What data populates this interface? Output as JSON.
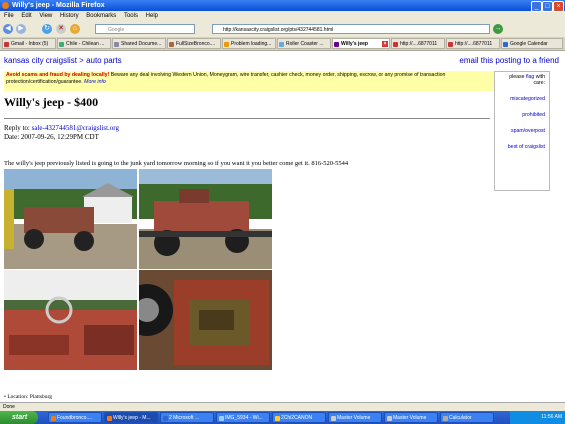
{
  "window": {
    "title": "Willy's jeep - Mozilla Firefox"
  },
  "menu": [
    "File",
    "Edit",
    "View",
    "History",
    "Bookmarks",
    "Tools",
    "Help"
  ],
  "nav": {
    "url": "http://kansascity.craigslist.org/pts/432744581.html",
    "search_placeholder": "Google"
  },
  "tabs": [
    {
      "label": "Gmail - Inbox (5)"
    },
    {
      "label": "Chile - Chilean ..."
    },
    {
      "label": "Shared Docume..."
    },
    {
      "label": "FullSizeBronco...."
    },
    {
      "label": "Problem loading..."
    },
    {
      "label": "Roller Coaster ..."
    },
    {
      "label": "Willy's jeep"
    },
    {
      "label": "http://....6877011"
    },
    {
      "label": "http://....6877011"
    },
    {
      "label": "Google Calendar"
    }
  ],
  "page": {
    "breadcrumb_site": "kansas city craigslist",
    "breadcrumb_sep": ">",
    "breadcrumb_section": "auto parts",
    "reply_link": "email this posting to a friend",
    "warning_bold": "Avoid scams and fraud by dealing locally!",
    "warning_text": "Beware any deal involving Western Union, Moneygram, wire transfer, cashier check, money order, shipping, escrow, or any promise of transaction protection/certification/guarantee.",
    "warning_link": "More info",
    "flag_prefix": "please",
    "flag_link": "flag",
    "flag_suffix": "with care:",
    "flag_options": [
      "miscategorized",
      "prohibited",
      "spam/overpost",
      "best of craigslist"
    ],
    "title": "Willy's jeep - $400",
    "reply_label": "Reply to:",
    "reply_email": "sale-432744581@craigslist.org",
    "date": "Date: 2007-09-26, 12:29PM CDT",
    "body": "The willy's jeep previously listed is going to the junk yard tomorrow morning so if you want it you better come get it. 816-520-5544",
    "location": "Location: Plattsburg"
  },
  "status": "Done",
  "taskbar": {
    "start": "start",
    "buttons": [
      "Foundbronco....",
      "Willy's jeep - M...",
      "2 Microsoft ...",
      "IMG_5934 - Wi...",
      "2Chi2CANON",
      "Master Volume",
      "Master Volume",
      "Calculator"
    ],
    "clock": "11:56 AM"
  },
  "colors": {
    "link": "#0000cc",
    "warning_bg": "#ffffa8",
    "titlebar": "#0a4fd6"
  }
}
